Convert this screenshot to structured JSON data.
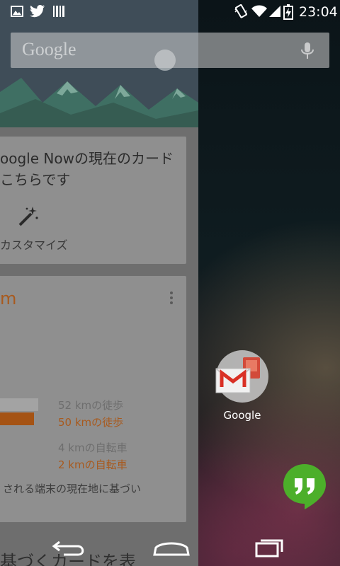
{
  "status_bar": {
    "left_icons": [
      "image-icon",
      "twitter-icon",
      "barcode-icon"
    ],
    "right_icons": [
      "vibrate-icon",
      "wifi-icon",
      "signal-icon",
      "battery-icon"
    ],
    "time": "23:04"
  },
  "search": {
    "logo": "Google",
    "mic_icon": "mic-icon"
  },
  "google_now": {
    "card1": {
      "title": "oogle Nowの現在のカード\nこちらです",
      "customize": "カスタマイズ",
      "icon": "magic-wand-icon"
    },
    "card2": {
      "unit": "m",
      "stats": [
        {
          "text": "52 kmの徒歩"
        },
        {
          "text": "50 kmの徒歩"
        },
        {
          "text": "4 kmの自転車"
        },
        {
          "text": "2 kmの自転車"
        }
      ],
      "footer": "される端末の現在地に基づい"
    },
    "bottom_text": "基づくカードを表"
  },
  "home": {
    "folder_label": "Google",
    "folder_icons": [
      "gmail-icon",
      "google-apps-icon"
    ],
    "hangouts_icon": "hangouts-icon"
  },
  "nav_bar": {
    "buttons": [
      "back-icon",
      "home-icon",
      "recents-icon"
    ]
  },
  "colors": {
    "accent_orange": "#f38d20",
    "hangouts_green": "#4caf2a",
    "gmail_red": "#d93025"
  }
}
